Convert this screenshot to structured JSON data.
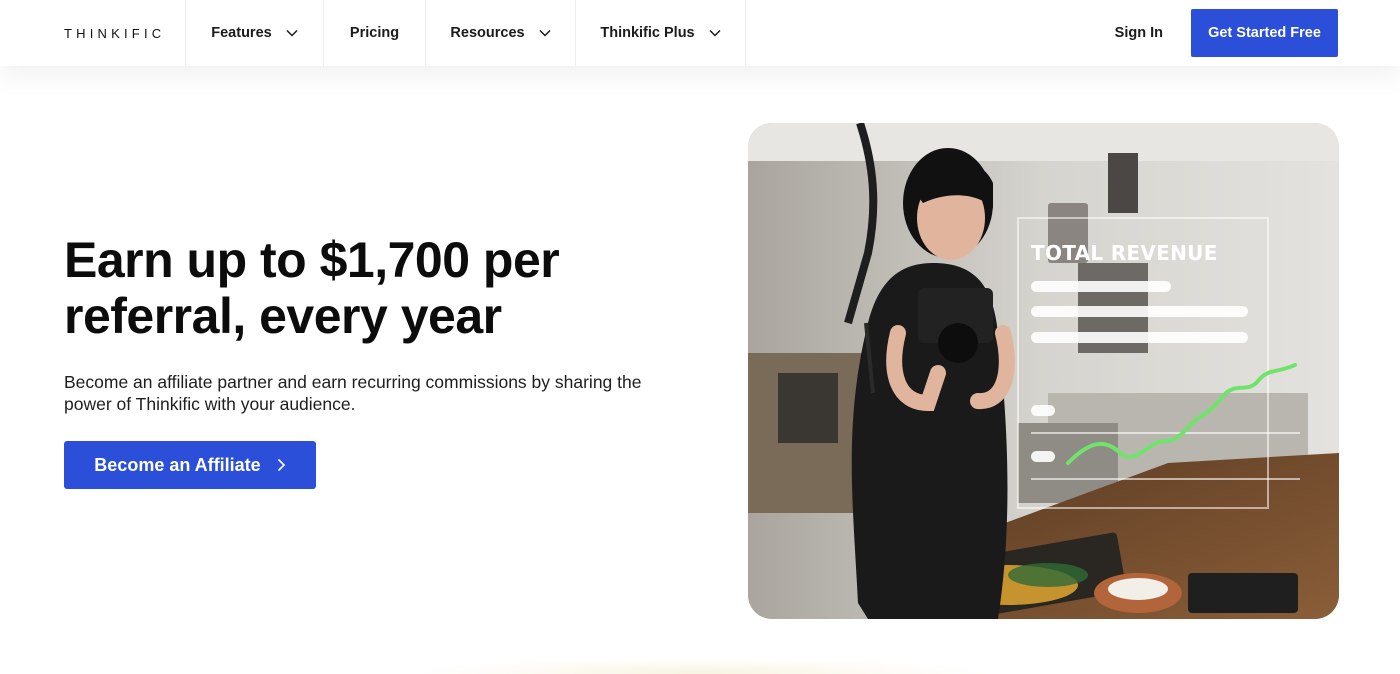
{
  "header": {
    "logo": "THINKIFIC",
    "nav": [
      {
        "label": "Features",
        "has_dropdown": true
      },
      {
        "label": "Pricing",
        "has_dropdown": false
      },
      {
        "label": "Resources",
        "has_dropdown": true
      },
      {
        "label": "Thinkific Plus",
        "has_dropdown": true
      }
    ],
    "sign_in": "Sign In",
    "cta": "Get Started Free"
  },
  "hero": {
    "title": "Earn up to $1,700 per referral, every year",
    "subtitle": "Become an affiliate partner and earn recurring commissions by sharing the power of Thinkific with your audience.",
    "cta": "Become an Affiliate"
  },
  "image": {
    "overlay_title": "TOTAL REVENUE",
    "icons": [
      "chevron-down-icon",
      "chevron-right-icon"
    ]
  },
  "colors": {
    "brand_blue": "#2b4fd8",
    "chart_green": "#6fe36a",
    "text_dark": "#0c0c0c"
  }
}
